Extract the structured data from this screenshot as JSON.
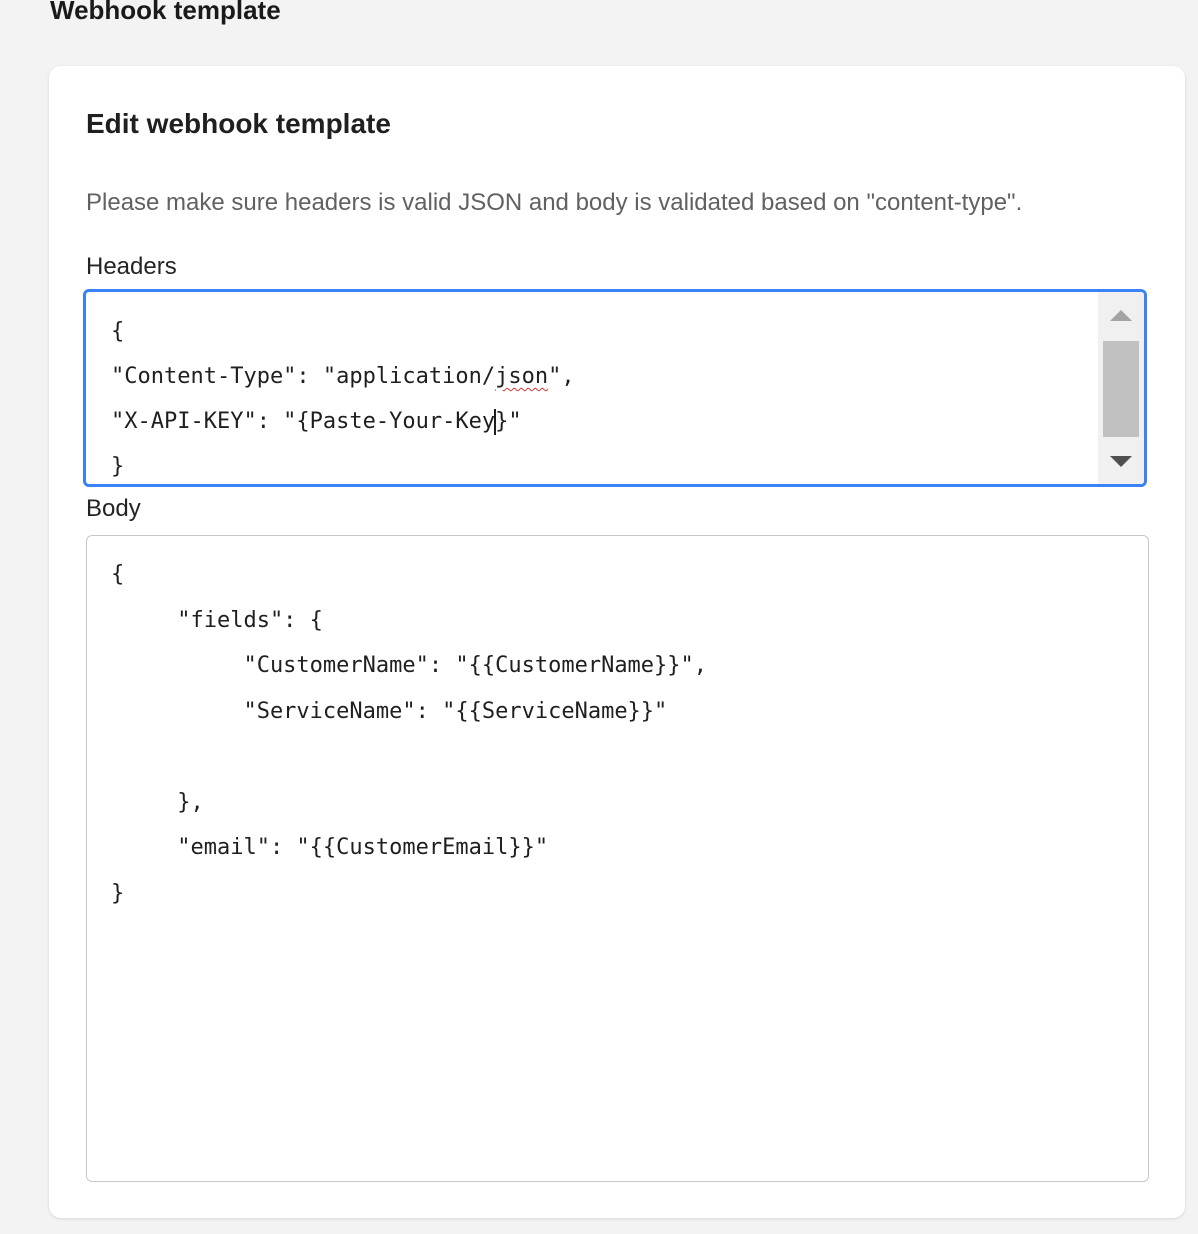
{
  "page": {
    "title": "Webhook template"
  },
  "card": {
    "title": "Edit webhook template",
    "description": "Please make sure headers is valid JSON and body is validated based on \"content-type\"."
  },
  "headers": {
    "label": "Headers",
    "lines": [
      "{",
      "\"Content-Type\": \"application/",
      "json",
      "\",",
      "\"X-API-KEY\": \"{Paste-Your-Key",
      "}\"",
      "}"
    ],
    "spellcheck_word": "json",
    "focused": true,
    "scrollbar": {
      "up_icon": "triangle-up",
      "down_icon": "triangle-down"
    }
  },
  "body": {
    "label": "Body",
    "lines": [
      "{",
      "     \"fields\": {",
      "          \"CustomerName\": \"{{CustomerName}}\",",
      "          \"ServiceName\": \"{{ServiceName}}\"",
      "",
      "     },",
      "     \"email\": \"{{CustomerEmail}}\"",
      "}"
    ]
  },
  "colors": {
    "focus_border": "#3b82f6",
    "background": "#f3f3f3",
    "card": "#ffffff",
    "muted_text": "#616161",
    "spellcheck_underline": "#d13438"
  }
}
